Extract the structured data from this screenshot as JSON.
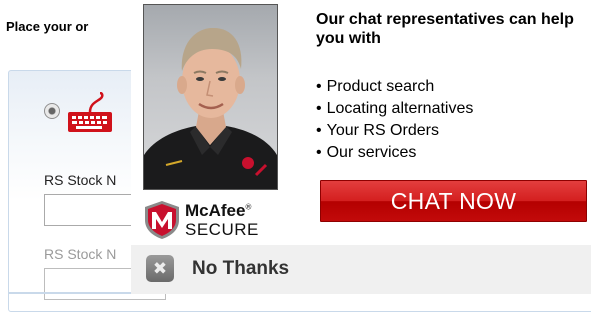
{
  "background_page": {
    "heading": "Place your or",
    "field1_label": "RS Stock N",
    "field2_label": "RS Stock N"
  },
  "chat_popup": {
    "headline": "Our chat representatives can help you with",
    "bullets": [
      "Product search",
      "Locating alternatives",
      "Your RS Orders",
      "Our services"
    ],
    "chat_button_label": "CHAT NOW",
    "mcafee_name": "McAfee",
    "mcafee_mark": "®",
    "mcafee_secure": "SECURE",
    "close_glyph": "✖",
    "no_thanks_label": "No Thanks"
  },
  "colors": {
    "chat_button": "#d41f1f",
    "keyboard_icon": "#d0121b",
    "mcafee_red": "#c8102e",
    "panel_border": "#c9d9ea"
  }
}
